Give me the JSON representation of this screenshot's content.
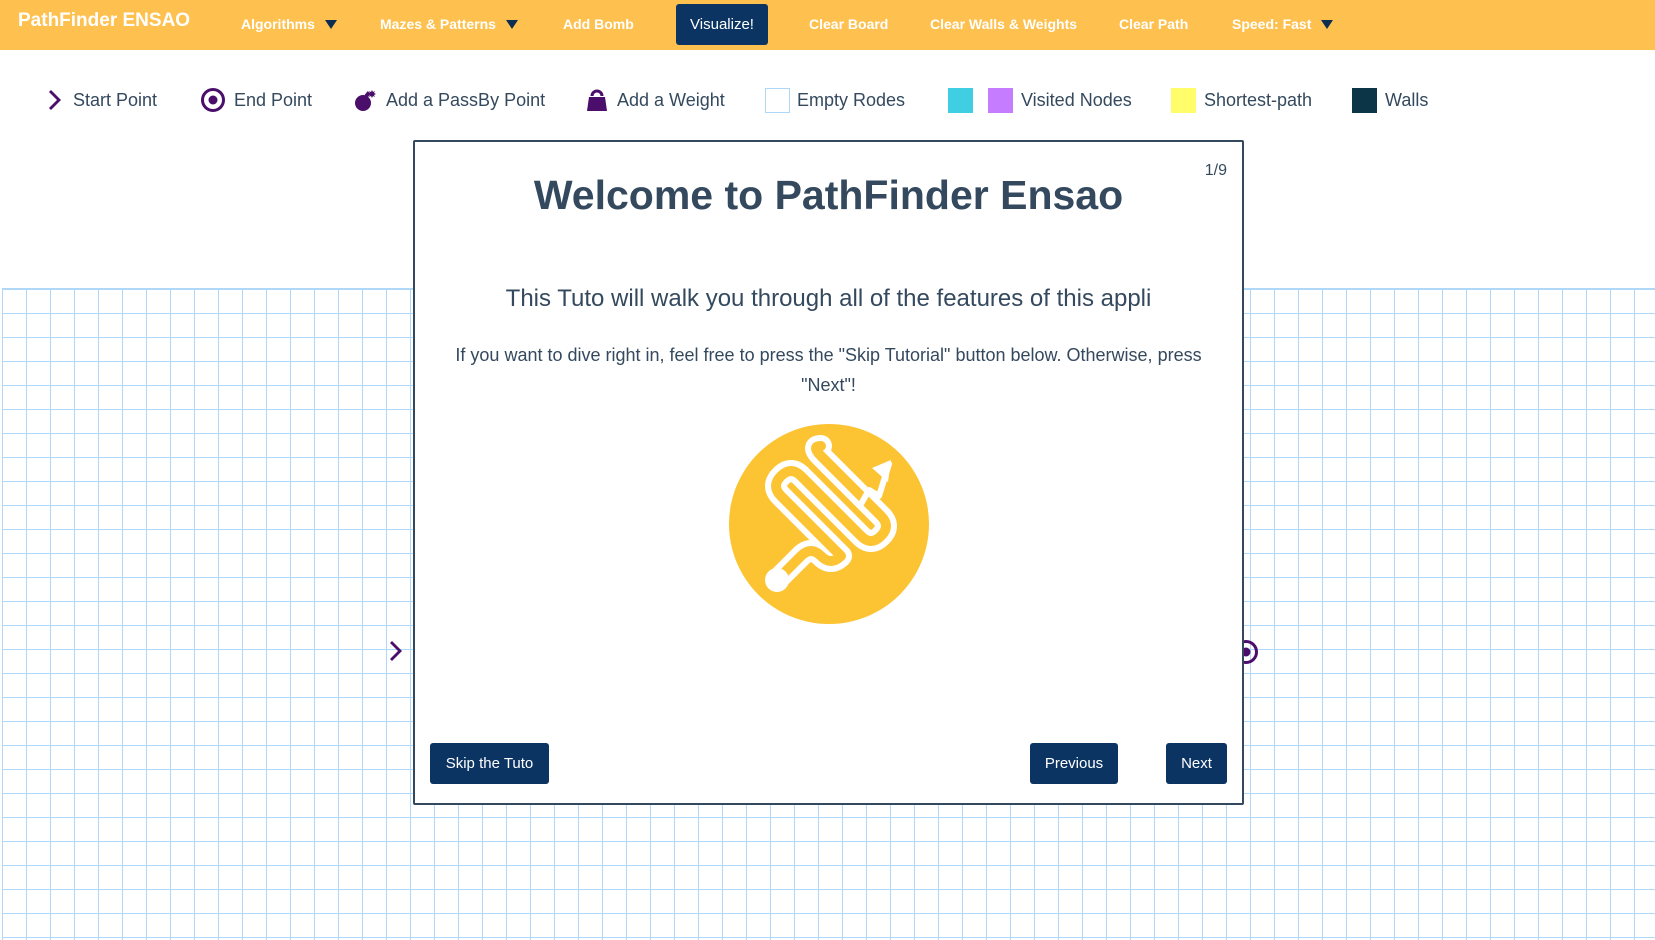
{
  "navbar": {
    "brand": "PathFinder ENSAO",
    "algorithms": "Algorithms",
    "mazes": "Mazes & Patterns",
    "add_bomb": "Add Bomb",
    "visualize": "Visualize!",
    "clear_board": "Clear Board",
    "clear_walls": "Clear Walls & Weights",
    "clear_path": "Clear Path",
    "speed": "Speed: Fast"
  },
  "legend": {
    "start": "Start Point",
    "end": "End Point",
    "passby": "Add a PassBy Point",
    "weight": "Add a Weight",
    "empty": "Empty Rodes",
    "visited": "Visited Nodes",
    "shortest": "Shortest-path",
    "walls": "Walls"
  },
  "modal": {
    "counter": "1/9",
    "title": "Welcome to PathFinder Ensao",
    "subtitle": "This Tuto will walk you through all of the features of this appli",
    "text": "If you want to dive right in, feel free to press the \"Skip Tutorial\" button below. Otherwise, press \"Next\"!",
    "skip": "Skip the Tuto",
    "previous": "Previous",
    "next": "Next"
  },
  "colors": {
    "navbar": "#fec150",
    "button": "#0c3463",
    "text": "#34495e",
    "node_accent": "#4b0e6b",
    "grid_line": "#afd8f8",
    "visited_primary": "#40cee3",
    "visited_secondary": "#c57cff",
    "shortest_path": "#fffe6a",
    "wall": "#0c3547",
    "logo": "#fcc433"
  },
  "icons": {
    "start": "chevron-right-icon",
    "end": "target-icon",
    "passby": "bomb-icon",
    "weight": "weight-icon",
    "logo": "path-arrow-logo"
  }
}
